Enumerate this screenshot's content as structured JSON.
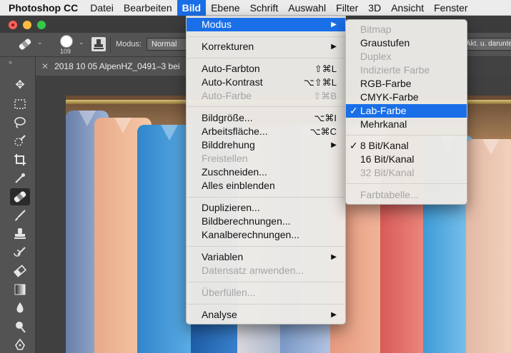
{
  "menubar": {
    "app": "Photoshop CC",
    "items": [
      "Datei",
      "Bearbeiten",
      "Bild",
      "Ebene",
      "Schrift",
      "Auswahl",
      "Filter",
      "3D",
      "Ansicht",
      "Fenster"
    ],
    "active": "Bild"
  },
  "options_bar": {
    "brush_size": "109",
    "modus_label": "Modus:",
    "modus_value": "Normal",
    "right_field": "Akt. u. darunter"
  },
  "document": {
    "tab_title": "2018 10 05 AlpenHZ_0491–3 bei"
  },
  "bild_menu": {
    "items": [
      {
        "label": "Modus",
        "submenu": true,
        "highlighted": true
      },
      {
        "label": "Korrekturen",
        "submenu": true
      },
      {
        "label": "Auto-Farbton",
        "shortcut": "⇧⌘L"
      },
      {
        "label": "Auto-Kontrast",
        "shortcut": "⌥⇧⌘L"
      },
      {
        "label": "Auto-Farbe",
        "shortcut": "⇧⌘B",
        "disabled": true
      },
      {
        "label": "Bildgröße...",
        "shortcut": "⌥⌘I"
      },
      {
        "label": "Arbeitsfläche...",
        "shortcut": "⌥⌘C"
      },
      {
        "label": "Bilddrehung",
        "submenu": true
      },
      {
        "label": "Freistellen",
        "disabled": true
      },
      {
        "label": "Zuschneiden..."
      },
      {
        "label": "Alles einblenden"
      },
      {
        "label": "Duplizieren..."
      },
      {
        "label": "Bildberechnungen..."
      },
      {
        "label": "Kanalberechnungen..."
      },
      {
        "label": "Variablen",
        "submenu": true
      },
      {
        "label": "Datensatz anwenden...",
        "disabled": true
      },
      {
        "label": "Überfüllen...",
        "disabled": true
      },
      {
        "label": "Analyse",
        "submenu": true
      }
    ]
  },
  "modus_submenu": {
    "items": [
      {
        "label": "Bitmap",
        "disabled": true
      },
      {
        "label": "Graustufen"
      },
      {
        "label": "Duplex",
        "disabled": true
      },
      {
        "label": "Indizierte Farbe",
        "disabled": true
      },
      {
        "label": "RGB-Farbe"
      },
      {
        "label": "CMYK-Farbe"
      },
      {
        "label": "Lab-Farbe",
        "checked": true,
        "highlighted": true
      },
      {
        "label": "Mehrkanal"
      },
      {
        "label": "8 Bit/Kanal",
        "checked": true
      },
      {
        "label": "16 Bit/Kanal"
      },
      {
        "label": "32 Bit/Kanal",
        "disabled": true
      },
      {
        "label": "Farbtabelle...",
        "disabled": true
      }
    ],
    "check_glyph": "✓"
  },
  "colors": {
    "accent": "#1a6fe8",
    "menu_bg": "#eceae6",
    "disabled_text": "#a5a5a5"
  },
  "icons": {
    "submenu": "▶",
    "tools": [
      "move-icon",
      "marquee-icon",
      "lasso-icon",
      "quick-select-icon",
      "crop-icon",
      "eyedropper-icon",
      "healing-brush-icon",
      "brush-icon",
      "clone-stamp-icon",
      "history-brush-icon",
      "eraser-icon",
      "gradient-icon",
      "blur-icon",
      "dodge-icon",
      "pen-icon"
    ]
  }
}
